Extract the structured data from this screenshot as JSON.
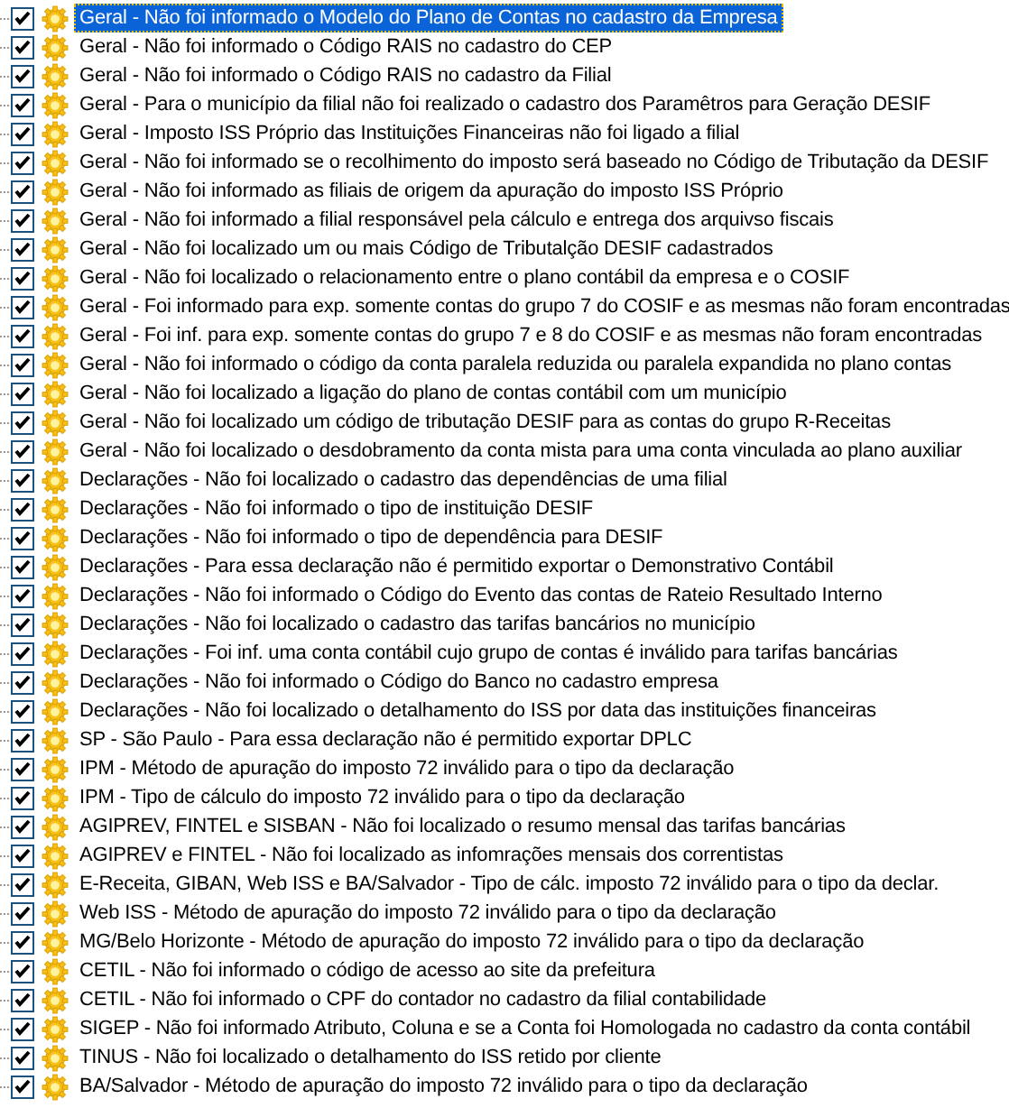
{
  "items": [
    {
      "text": "Geral - Não foi informado o Modelo do Plano de Contas no cadastro da Empresa",
      "checked": true,
      "selected": true
    },
    {
      "text": "Geral - Não foi informado o Código RAIS no cadastro do CEP",
      "checked": true,
      "selected": false
    },
    {
      "text": "Geral - Não foi informado o Código RAIS no cadastro da Filial",
      "checked": true,
      "selected": false
    },
    {
      "text": "Geral - Para o município da filial não foi realizado o cadastro dos Paramêtros para Geração DESIF",
      "checked": true,
      "selected": false
    },
    {
      "text": "Geral - Imposto ISS Próprio das Instituições Financeiras não foi ligado a filial",
      "checked": true,
      "selected": false
    },
    {
      "text": "Geral - Não foi informado se o recolhimento do imposto será baseado no Código de Tributação da DESIF",
      "checked": true,
      "selected": false
    },
    {
      "text": "Geral - Não foi informado as filiais de origem da apuração do imposto ISS Próprio",
      "checked": true,
      "selected": false
    },
    {
      "text": "Geral - Não foi informado a filial responsável pela cálculo e entrega dos arquivso fiscais",
      "checked": true,
      "selected": false
    },
    {
      "text": "Geral - Não foi localizado um ou mais Código de Tributalção DESIF cadastrados",
      "checked": true,
      "selected": false
    },
    {
      "text": "Geral - Não foi localizado o relacionamento entre o plano contábil da empresa e o COSIF",
      "checked": true,
      "selected": false
    },
    {
      "text": "Geral - Foi informado para exp. somente contas do grupo 7 do COSIF e as mesmas não foram encontradas",
      "checked": true,
      "selected": false
    },
    {
      "text": "Geral - Foi inf. para exp. somente contas do grupo 7 e 8 do COSIF e as mesmas não foram encontradas",
      "checked": true,
      "selected": false
    },
    {
      "text": "Geral - Não foi informado o código da conta paralela reduzida ou paralela expandida no plano contas",
      "checked": true,
      "selected": false
    },
    {
      "text": "Geral - Não foi localizado a ligação do plano de contas contábil com um município",
      "checked": true,
      "selected": false
    },
    {
      "text": "Geral - Não foi localizado um código de tributação DESIF para as contas do grupo R-Receitas",
      "checked": true,
      "selected": false
    },
    {
      "text": "Geral - Não foi localizado o desdobramento da conta mista para uma conta vinculada ao plano auxiliar",
      "checked": true,
      "selected": false
    },
    {
      "text": "Declarações - Não foi localizado o cadastro das dependências de uma filial",
      "checked": true,
      "selected": false
    },
    {
      "text": "Declarações - Não foi informado o tipo de instituição DESIF",
      "checked": true,
      "selected": false
    },
    {
      "text": "Declarações - Não foi informado o tipo de dependência para DESIF",
      "checked": true,
      "selected": false
    },
    {
      "text": "Declarações - Para essa declaração não é permitido exportar o Demonstrativo Contábil",
      "checked": true,
      "selected": false
    },
    {
      "text": "Declarações - Não foi informado o Código do Evento das contas de Rateio Resultado Interno",
      "checked": true,
      "selected": false
    },
    {
      "text": "Declarações - Não foi localizado o cadastro das tarifas bancários no município",
      "checked": true,
      "selected": false
    },
    {
      "text": "Declarações - Foi inf. uma conta contábil cujo grupo de contas é inválido para tarifas bancárias",
      "checked": true,
      "selected": false
    },
    {
      "text": "Declarações - Não foi informado o Código do Banco no cadastro empresa",
      "checked": true,
      "selected": false
    },
    {
      "text": "Declarações - Não foi localizado o detalhamento do ISS por data das instituições financeiras",
      "checked": true,
      "selected": false
    },
    {
      "text": "SP - São Paulo - Para essa declaração não é permitido exportar DPLC",
      "checked": true,
      "selected": false
    },
    {
      "text": "IPM - Método de apuração do imposto 72 inválido para o tipo da declaração",
      "checked": true,
      "selected": false
    },
    {
      "text": "IPM - Tipo de cálculo do imposto 72 inválido para o tipo da declaração",
      "checked": true,
      "selected": false
    },
    {
      "text": "AGIPREV, FINTEL e SISBAN - Não foi localizado o resumo mensal das tarifas bancárias",
      "checked": true,
      "selected": false
    },
    {
      "text": "AGIPREV e FINTEL - Não foi localizado as infomrações mensais dos correntistas",
      "checked": true,
      "selected": false
    },
    {
      "text": "E-Receita, GIBAN, Web ISS e BA/Salvador - Tipo de cálc. imposto 72 inválido para o tipo da declar.",
      "checked": true,
      "selected": false
    },
    {
      "text": "Web ISS - Método de apuração do imposto 72 inválido para o tipo da declaração",
      "checked": true,
      "selected": false
    },
    {
      "text": "MG/Belo Horizonte - Método de apuração do imposto 72 inválido para o tipo da declaração",
      "checked": true,
      "selected": false
    },
    {
      "text": "CETIL - Não foi informado o código de acesso ao site da prefeitura",
      "checked": true,
      "selected": false
    },
    {
      "text": "CETIL - Não foi informado o CPF do contador no cadastro da filial contabilidade",
      "checked": true,
      "selected": false
    },
    {
      "text": "SIGEP - Não foi informado Atributo, Coluna e se a Conta foi Homologada no cadastro da conta contábil",
      "checked": true,
      "selected": false
    },
    {
      "text": "TINUS - Não foi localizado o detalhamento do ISS retido por cliente",
      "checked": true,
      "selected": false
    },
    {
      "text": "BA/Salvador - Método de apuração do imposto 72 inválido para o tipo da declaração",
      "checked": true,
      "selected": false
    }
  ]
}
